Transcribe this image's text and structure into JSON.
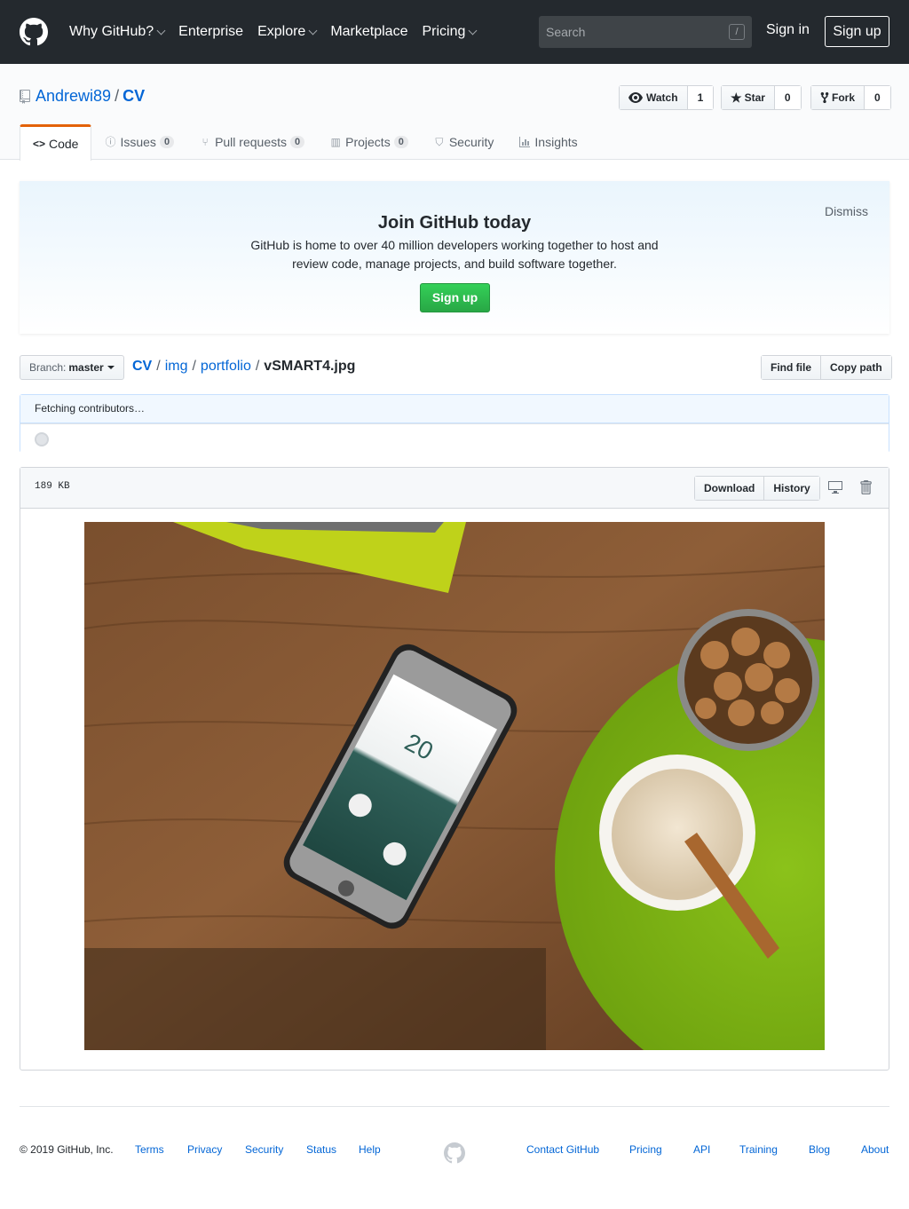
{
  "header": {
    "nav": [
      "Why GitHub?",
      "Enterprise",
      "Explore",
      "Marketplace",
      "Pricing"
    ],
    "nav_dropdown": [
      true,
      false,
      true,
      false,
      true
    ],
    "search_placeholder": "Search",
    "search_shortcut": "/",
    "signin": "Sign in",
    "signup": "Sign up"
  },
  "repo": {
    "owner": "Andrewi89",
    "separator": "/",
    "name": "CV",
    "watch_label": "Watch",
    "watch_count": "1",
    "star_label": "Star",
    "star_count": "0",
    "fork_label": "Fork",
    "fork_count": "0"
  },
  "tabs": [
    {
      "label": "Code",
      "icon": "code-icon",
      "counter": ""
    },
    {
      "label": "Issues",
      "icon": "issue-icon",
      "counter": "0"
    },
    {
      "label": "Pull requests",
      "icon": "pull-request-icon",
      "counter": "0"
    },
    {
      "label": "Projects",
      "icon": "project-icon",
      "counter": "0"
    },
    {
      "label": "Security",
      "icon": "shield-icon",
      "counter": ""
    },
    {
      "label": "Insights",
      "icon": "graph-icon",
      "counter": ""
    }
  ],
  "banner": {
    "title": "Join GitHub today",
    "text": "GitHub is home to over 40 million developers working together to host and review code, manage projects, and build software together.",
    "signup": "Sign up",
    "dismiss": "Dismiss"
  },
  "filenav": {
    "branch_prefix": "Branch:",
    "branch": "master",
    "crumbs": [
      "CV",
      "img",
      "portfolio"
    ],
    "filename": "vSMART4.jpg",
    "find_file": "Find file",
    "copy_path": "Copy path"
  },
  "contributors": {
    "status": "Fetching contributors…"
  },
  "file": {
    "size": "189 KB",
    "download": "Download",
    "history": "History"
  },
  "footer": {
    "copyright": "© 2019 GitHub, Inc.",
    "left_links": [
      "Terms",
      "Privacy",
      "Security",
      "Status",
      "Help"
    ],
    "right_links": [
      "Contact GitHub",
      "Pricing",
      "API",
      "Training",
      "Blog",
      "About"
    ]
  },
  "colors": {
    "header_bg": "#24292e",
    "link": "#0366d6",
    "tab_accent": "#e36209",
    "signup_green": "#28a745"
  }
}
